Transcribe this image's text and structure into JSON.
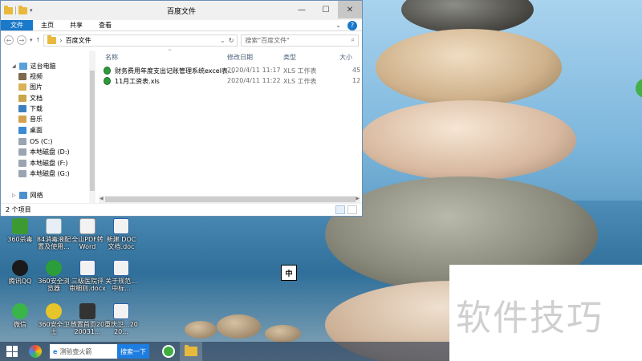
{
  "window": {
    "title": "百度文件",
    "ribbon_tabs": [
      "文件",
      "主页",
      "共享",
      "查看"
    ],
    "help_label": "?",
    "address": "百度文件",
    "search_placeholder": "搜索\"百度文件\"",
    "nav": {
      "this_pc": "这台电脑",
      "items": [
        "视频",
        "图片",
        "文档",
        "下载",
        "音乐",
        "桌面",
        "OS (C:)",
        "本地磁盘 (D:)",
        "本地磁盘 (F:)",
        "本地磁盘 (G:)"
      ],
      "network": "网络"
    },
    "columns": [
      "名称",
      "修改日期",
      "类型",
      "大小"
    ],
    "files": [
      {
        "name": "财务费用年度支出记账管理系统excel表...",
        "modified": "2020/4/11 11:17",
        "type": "XLS 工作表",
        "size": "45"
      },
      {
        "name": "11月工资表.xls",
        "modified": "2020/4/11 11:22",
        "type": "XLS 工作表",
        "size": "12"
      }
    ],
    "status": "2 个项目"
  },
  "desktop_icons": [
    {
      "label": "360杀毒",
      "icon": "360-antivirus-icon",
      "color": "#3d9a33"
    },
    {
      "label": "腾讯QQ",
      "icon": "qq-icon",
      "color": "#1a1a1a"
    },
    {
      "label": "微信",
      "icon": "wechat-icon",
      "color": "#39b54a"
    },
    {
      "label": "84消毒液配置及使用...",
      "icon": "document-icon",
      "color": "#e8eef5"
    },
    {
      "label": "360安全浏览器",
      "icon": "360-browser-icon",
      "color": "#2b9d3a"
    },
    {
      "label": "360安全卫士",
      "icon": "360-guard-icon",
      "color": "#e6c52a"
    },
    {
      "label": "全山PDF转Word",
      "icon": "pdf-word-icon",
      "color": "#f2f2f2"
    },
    {
      "label": "三级医院评审细则.docx",
      "icon": "word-doc-icon",
      "color": "#f2f2f2"
    },
    {
      "label": "放置首页2020031...",
      "icon": "file-icon",
      "color": "#333333"
    },
    {
      "label": "新建 DOC 文档.doc",
      "icon": "word-doc-icon",
      "color": "#f2f2f2"
    },
    {
      "label": "关于规范...中标...",
      "icon": "word-doc-icon",
      "color": "#f2f2f2"
    },
    {
      "label": "重庆卫...2020...",
      "icon": "word-doc-icon",
      "color": "#f2f2f2"
    }
  ],
  "ime_indicator": "中",
  "watermark": "软件技巧",
  "taskbar": {
    "search_placeholder": "测验壶火箭",
    "search_button": "搜索一下"
  }
}
